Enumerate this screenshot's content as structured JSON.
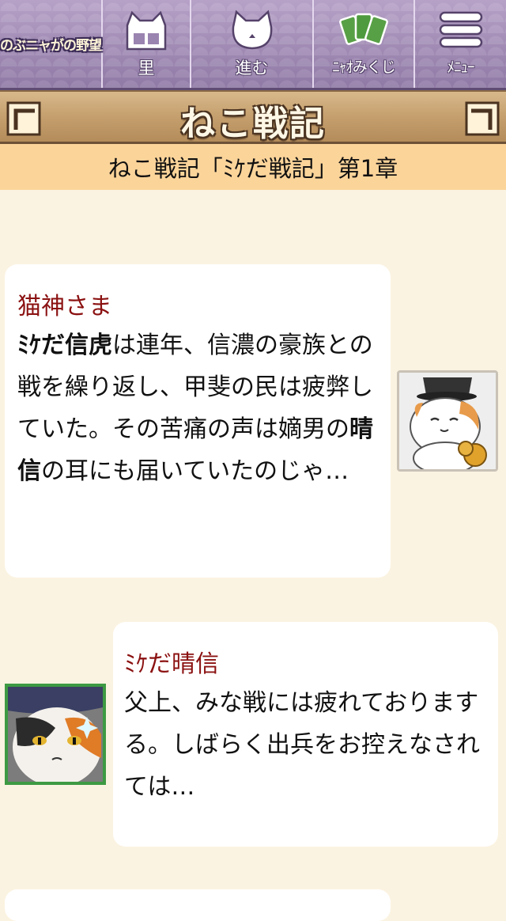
{
  "nav": {
    "logo_text": "のぶニャがの野望",
    "items": [
      {
        "label": "里",
        "icon": "house-cat-icon"
      },
      {
        "label": "進む",
        "icon": "cat-face-icon"
      },
      {
        "label": "ﾆｬｵみくじ",
        "icon": "cards-icon"
      },
      {
        "label": "ﾒﾆｭｰ",
        "icon": "menu-icon"
      }
    ]
  },
  "title": "ねこ戦記",
  "chapter": "ねこ戦記「ﾐｹだ戦記」第1章",
  "dialogue": [
    {
      "speaker": "猫神さま",
      "parts": [
        {
          "text": "ﾐｹだ信虎",
          "bold": true
        },
        {
          "text": "は連年、信濃の豪族との戦を繰り返し、甲斐の民は疲弊していた。その苦痛の声は嫡男の",
          "bold": false
        },
        {
          "text": "晴信",
          "bold": true
        },
        {
          "text": "の耳にも届いていたのじゃ…",
          "bold": false
        }
      ],
      "avatar": "cat-monk-avatar"
    },
    {
      "speaker": "ﾐｹだ晴信",
      "parts": [
        {
          "text": "父上、みな戦には疲れておりまする。しばらく出兵をお控えなされては…",
          "bold": false
        }
      ],
      "avatar": "calico-warrior-avatar"
    }
  ],
  "colors": {
    "nav_bg": "#9a84b0",
    "title_bg": "#c39d6b",
    "chapter_bg": "#fbd49a",
    "page_bg": "#fbf3e1",
    "speaker_color": "#8b1111"
  }
}
